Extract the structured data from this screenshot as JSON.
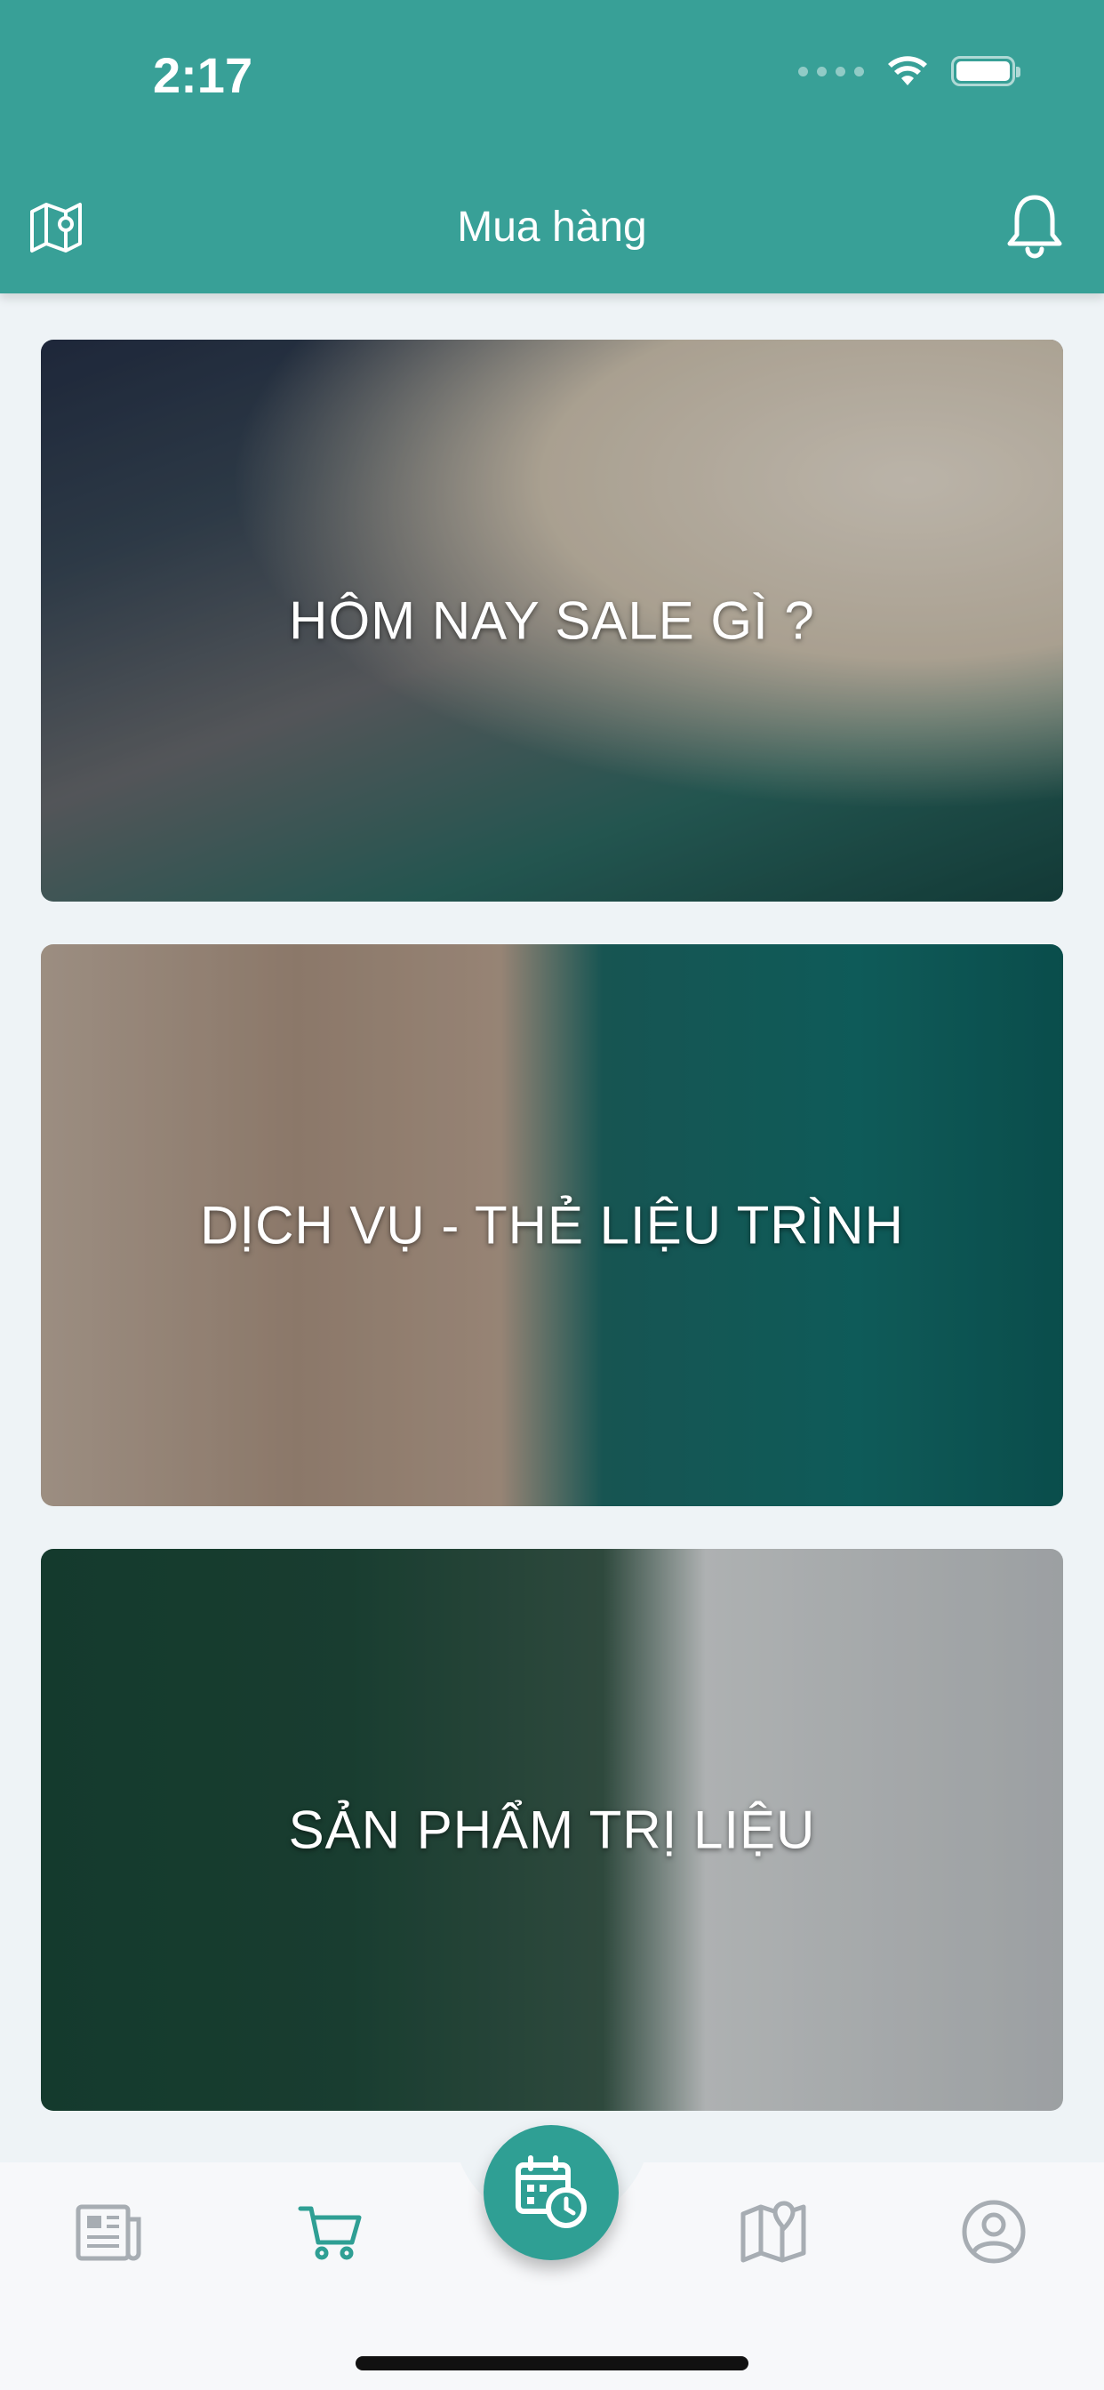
{
  "status_bar": {
    "time": "2:17"
  },
  "header": {
    "title": "Mua hàng"
  },
  "cards": [
    {
      "label": "HÔM NAY SALE GÌ ?"
    },
    {
      "label": "DỊCH VỤ - THẺ LIỆU TRÌNH"
    },
    {
      "label": "SẢN PHẨM TRỊ LIỆU"
    }
  ],
  "tabbar": {
    "items": [
      {
        "icon": "newspaper-icon"
      },
      {
        "icon": "cart-icon",
        "active": true
      },
      {
        "icon": "calendar-clock-icon"
      },
      {
        "icon": "map-pin-icon"
      },
      {
        "icon": "user-icon"
      }
    ]
  },
  "colors": {
    "primary": "#38a097",
    "active_tab": "#2f9f94",
    "inactive_tab": "#a7adb3"
  }
}
